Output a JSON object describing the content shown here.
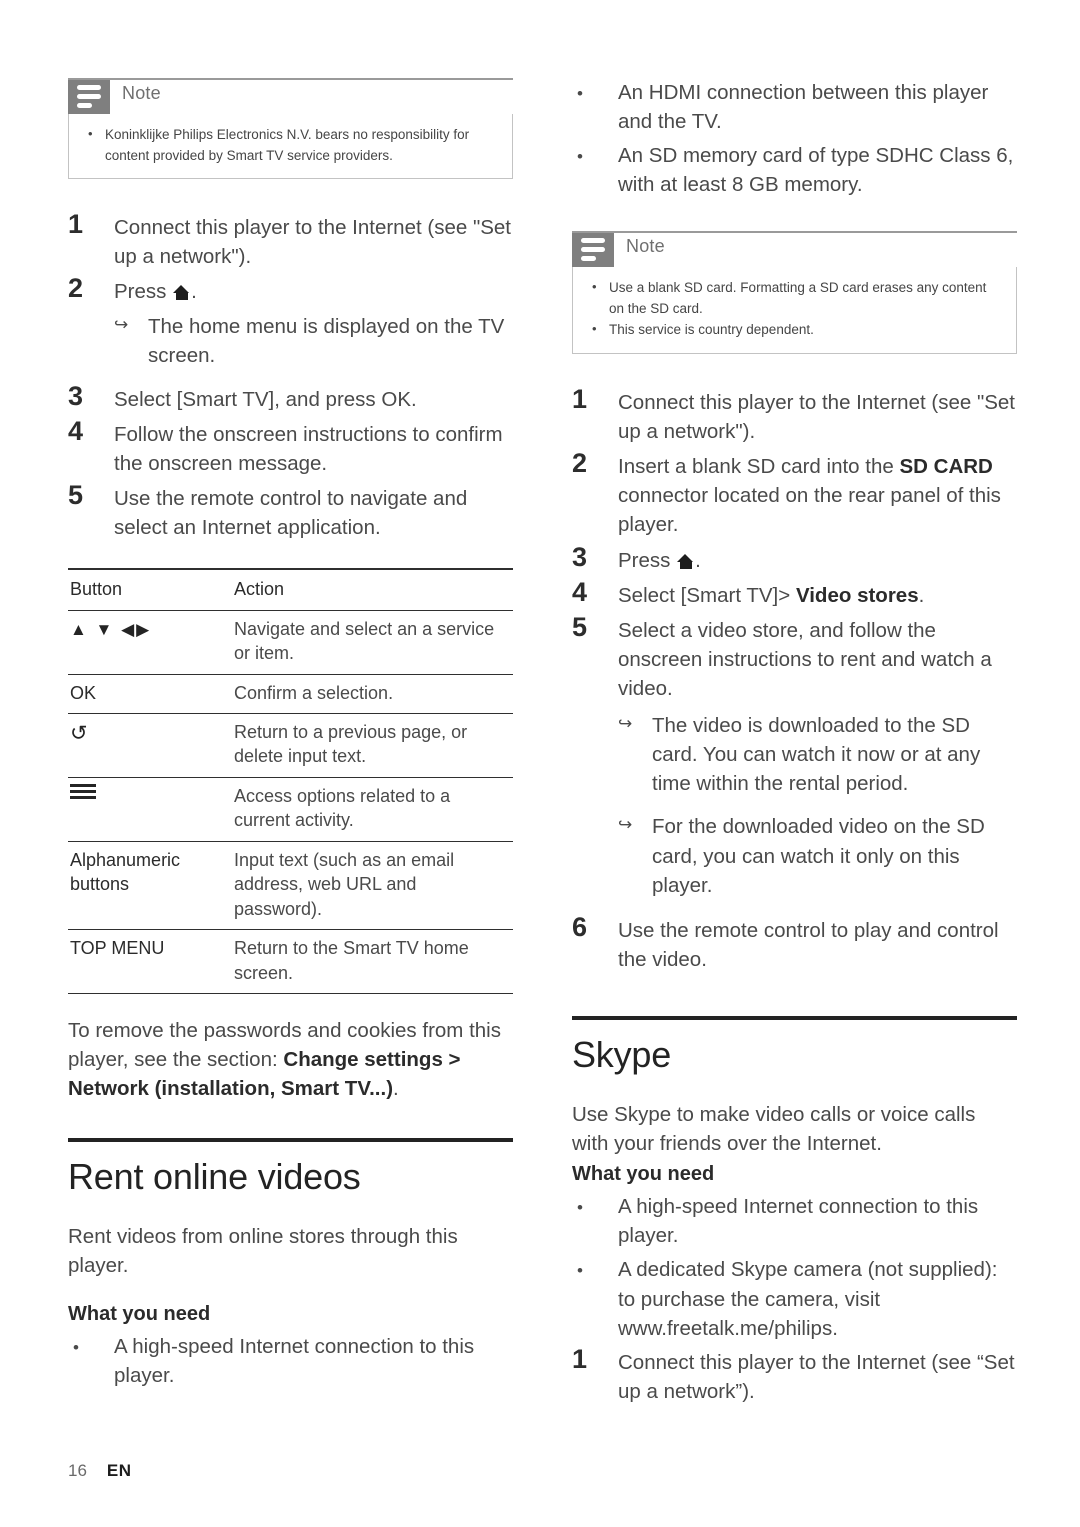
{
  "page": {
    "number": "16",
    "language": "EN"
  },
  "left_column": {
    "note": {
      "title": "Note",
      "items": [
        "Koninklijke Philips Electronics N.V. bears no responsibility for content provided by Smart TV service providers."
      ]
    },
    "steps": [
      {
        "num": "1",
        "text": "Connect this player to the Internet (see \"Set up a network\")."
      },
      {
        "num": "2",
        "text": "Press ",
        "icon": "home-icon",
        "text_after": "."
      },
      {
        "num": "3",
        "text": "Select [Smart TV], and press OK."
      },
      {
        "num": "4",
        "text": "Follow the onscreen instructions to confirm the onscreen message."
      },
      {
        "num": "5",
        "text": "Use the remote control to navigate and select an Internet application."
      }
    ],
    "step2_result": "The home menu is displayed on the TV screen.",
    "table": {
      "headers": [
        "Button",
        "Action"
      ],
      "rows": [
        {
          "button_icon": "direction-pad-arrows-icon",
          "button": "▲ ▼ ◀▶",
          "action": "Navigate and select an a service or item."
        },
        {
          "button_icon": "ok-text",
          "button": "OK",
          "action": "Confirm a selection."
        },
        {
          "button_icon": "back-arrow-icon",
          "button": "↺",
          "action": "Return to a previous page, or delete input text."
        },
        {
          "button_icon": "options-list-icon",
          "button": "",
          "action": "Access options related to a current activity."
        },
        {
          "button_icon": "",
          "button": "Alphanumeric buttons",
          "action": "Input text (such as an email address, web URL and password)."
        },
        {
          "button_icon": "",
          "button": "TOP MENU",
          "action": "Return to the Smart TV home screen."
        }
      ]
    },
    "closing_paragraph": {
      "lead": "To remove the passwords and cookies from this player, see the section: ",
      "bold": "Change settings > Network (installation, Smart TV...)",
      "tail": "."
    },
    "section": {
      "heading": "Rent online videos",
      "intro": "Rent videos from online stores through this player.",
      "subhead": "What you need",
      "requirements": [
        "A high-speed Internet connection to this player."
      ]
    }
  },
  "right_column": {
    "requirements_continued": [
      "An HDMI connection between this player and the TV.",
      "An SD memory card of type SDHC Class 6, with at least 8 GB memory."
    ],
    "note": {
      "title": "Note",
      "items": [
        "Use a blank SD card. Formatting a SD card erases any content on the SD card.",
        "This service is country dependent."
      ]
    },
    "steps": [
      {
        "num": "1",
        "text": "Connect this player to the Internet (see \"Set up a network\")."
      },
      {
        "num": "2",
        "text_lead": "Insert a blank SD card into the ",
        "bold": "SD CARD",
        "text_tail": " connector located on the rear panel of this player."
      },
      {
        "num": "3",
        "text": "Press ",
        "icon": "home-icon",
        "text_after": "."
      },
      {
        "num": "4",
        "text_lead": "Select [Smart TV]> ",
        "bold": "Video stores",
        "text_tail": "."
      },
      {
        "num": "5",
        "text": "Select a video store, and follow the onscreen instructions to rent and watch a video."
      },
      {
        "num": "6",
        "text": "Use the remote control to play and control the video."
      }
    ],
    "step5_results": [
      "The video is downloaded to the SD card. You can watch it now or at any time within the rental period.",
      "For the downloaded video on the SD card, you can watch it only on this player."
    ],
    "section": {
      "heading": "Skype",
      "intro": "Use Skype to make video calls or voice calls with your friends over the Internet.",
      "subhead": "What you need",
      "requirements": [
        "A high-speed Internet connection to this player.",
        "A dedicated Skype camera (not supplied): to purchase the camera, visit www.freetalk.me/philips."
      ],
      "steps": [
        {
          "num": "1",
          "text": "Connect this player to the Internet (see “Set up a network”)."
        }
      ]
    }
  },
  "colors": {
    "note_icon_bg": "#7f7f7f",
    "note_border": "#c3c3c3",
    "heading_rule": "#232323",
    "body_text": "#4a4a4a"
  }
}
